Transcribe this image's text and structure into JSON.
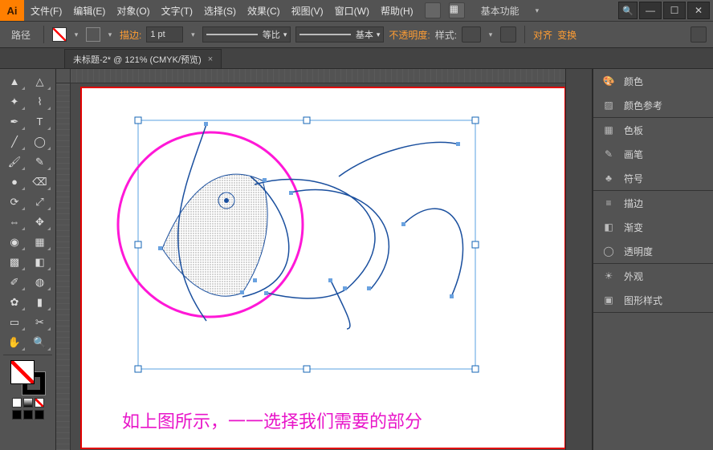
{
  "app": {
    "logo": "Ai",
    "workspace_label": "基本功能"
  },
  "menus": [
    {
      "label": "文件(F)"
    },
    {
      "label": "编辑(E)"
    },
    {
      "label": "对象(O)"
    },
    {
      "label": "文字(T)"
    },
    {
      "label": "选择(S)"
    },
    {
      "label": "效果(C)"
    },
    {
      "label": "视图(V)"
    },
    {
      "label": "窗口(W)"
    },
    {
      "label": "帮助(H)"
    }
  ],
  "options": {
    "context_label": "路径",
    "stroke_label": "描边:",
    "stroke_value": "1 pt",
    "profile_label": "等比",
    "brush_label": "基本",
    "opacity_label": "不透明度:",
    "style_label": "样式:",
    "align_label": "对齐",
    "transform_label": "变换"
  },
  "doc_tab": {
    "title": "未标题-2* @ 121% (CMYK/预览)",
    "close": "×"
  },
  "panels": {
    "group1": [
      {
        "icon": "🎨",
        "label": "颜色"
      },
      {
        "icon": "▨",
        "label": "颜色参考"
      }
    ],
    "group2": [
      {
        "icon": "▦",
        "label": "色板"
      },
      {
        "icon": "✎",
        "label": "画笔"
      },
      {
        "icon": "♣",
        "label": "符号"
      }
    ],
    "group3": [
      {
        "icon": "≡",
        "label": "描边"
      },
      {
        "icon": "◧",
        "label": "渐变"
      },
      {
        "icon": "◯",
        "label": "透明度"
      }
    ],
    "group4": [
      {
        "icon": "☀",
        "label": "外观"
      },
      {
        "icon": "▣",
        "label": "图形样式"
      }
    ]
  },
  "canvas": {
    "caption": "如上图所示，一一选择我们需要的部分"
  },
  "tools": [
    "sel",
    "dsel",
    "wand",
    "lasso",
    "pen",
    "type",
    "line",
    "ellipse",
    "brush",
    "pencil",
    "blob",
    "eraser",
    "rotate",
    "scale",
    "width",
    "free",
    "shapebuilder",
    "perspective",
    "mesh",
    "gradient",
    "eyedrop",
    "blend",
    "symbol",
    "graph",
    "artboard",
    "slice",
    "hand",
    "zoom"
  ]
}
